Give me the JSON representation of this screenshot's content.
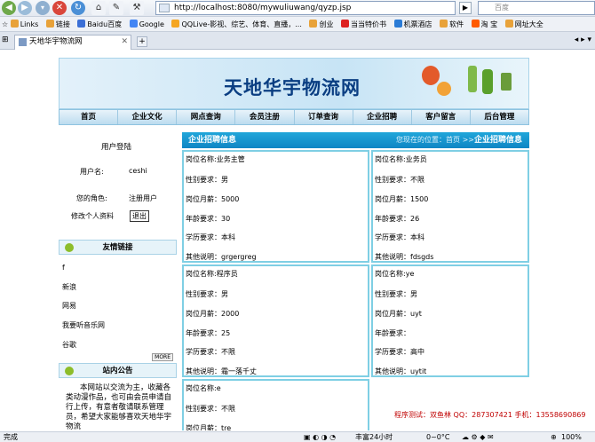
{
  "browser": {
    "url": "http://localhost:8080/mywuliuwang/qyzp.jsp",
    "search_placeholder": "百度",
    "tab_title": "天地华宇物流网",
    "bookmarks": [
      "Links",
      "链接",
      "Baidu百度",
      "Google",
      "QQLive-影视、综艺、体育、直播，...",
      "创业",
      "当当特价书",
      "机票酒店",
      "软件",
      "淘 宝",
      "网址大全"
    ],
    "status_left": "完成",
    "status_weather": "丰富24小时",
    "status_temp": "0~0°C",
    "zoom": "100%"
  },
  "site": {
    "title": "天地华宇物流网",
    "nav": [
      "首页",
      "企业文化",
      "网点查询",
      "会员注册",
      "订单查询",
      "企业招聘",
      "客户留言",
      "后台管理"
    ]
  },
  "sidebar": {
    "login_title": "用户登陆",
    "username_label": "用户名:",
    "username_value": "ceshi",
    "role_label": "您的角色:",
    "role_value": "注册用户",
    "edit_profile": "修改个人资料",
    "logout_label": "退出",
    "links_title": "友情链接",
    "links": [
      "f",
      "新浪",
      "网易",
      "我要听音乐网",
      "谷歌"
    ],
    "more_label": "MORE",
    "notice_title": "站内公告",
    "notice_text": "本网站以交流为主，收藏各类动漫作品，也可由会员申请自行上传，有意者敬请联系管理员，希望大家能够喜欢天地华宇物流"
  },
  "main": {
    "header": "企业招聘信息",
    "crumb_prefix": "您现在的位置：首页",
    "crumb_sep": ">>",
    "crumb_current": "企业招聘信息",
    "labels": {
      "position": "岗位名称:",
      "gender": "性别要求：",
      "salary": "岗位月薪：",
      "age": "年龄要求：",
      "education": "学历要求：",
      "other": "其他说明："
    },
    "jobs": [
      {
        "position": "业务主管",
        "gender": "男",
        "salary": "5000",
        "age": "30",
        "education": "本科",
        "other": "grgergreg"
      },
      {
        "position": "业务员",
        "gender": "不限",
        "salary": "1500",
        "age": "26",
        "education": "本科",
        "other": "fdsgds"
      },
      {
        "position": "程序员",
        "gender": "男",
        "salary": "2000",
        "age": "25",
        "education": "不限",
        "other": "霜一落千丈"
      },
      {
        "position": "ye",
        "gender": "男",
        "salary": "uyt",
        "age": "",
        "education": "高中",
        "other": "uytit"
      },
      {
        "position": "e",
        "gender": "不限",
        "salary": "tre",
        "age": "",
        "education": "",
        "other": ""
      }
    ]
  },
  "footer": "程序测试：双鱼林  QQ：287307421  手机：13558690869"
}
